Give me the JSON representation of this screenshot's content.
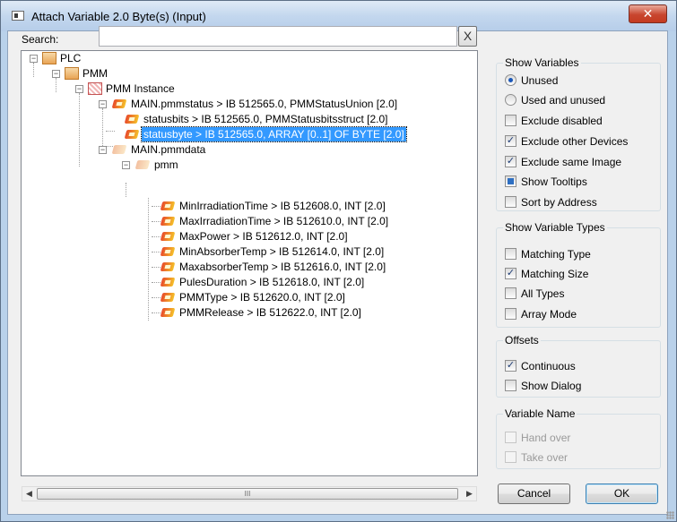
{
  "window": {
    "title": "Attach Variable 2.0 Byte(s) (Input)",
    "close_glyph": "✕"
  },
  "search": {
    "label": "Search:",
    "value": "",
    "clear_glyph": "X"
  },
  "tree": {
    "plc": "PLC",
    "pmm": "PMM",
    "pmm_instance": "PMM Instance",
    "pmmstatus": "MAIN.pmmstatus   >   IB 512565.0, PMMStatusUnion [2.0]",
    "statusbits": "statusbits   >   IB 512565.0, PMMStatusbitsstruct [2.0]",
    "statusbyte": "statusbyte   >   IB 512565.0, ARRAY [0..1] OF BYTE [2.0]",
    "pmmdata": "MAIN.pmmdata",
    "pmm_struct": "pmm",
    "items": [
      "MinIrradiationTime   >   IB 512608.0, INT [2.0]",
      "MaxIrradiationTime   >   IB 512610.0, INT [2.0]",
      "MaxPower   >   IB 512612.0, INT [2.0]",
      "MinAbsorberTemp   >   IB 512614.0, INT [2.0]",
      "MaxabsorberTemp   >   IB 512616.0, INT [2.0]",
      "PulesDuration   >   IB 512618.0, INT [2.0]",
      "PMMType   >   IB 512620.0, INT [2.0]",
      "PMMRelease   >   IB 512622.0, INT [2.0]"
    ]
  },
  "scrollbar": {
    "thumb_glyph": "III",
    "left_glyph": "◀",
    "right_glyph": "▶"
  },
  "show_variables": {
    "title": "Show Variables",
    "unused": "Unused",
    "used_and_unused": "Used and unused",
    "exclude_disabled": "Exclude disabled",
    "exclude_other_devices": "Exclude other Devices",
    "exclude_same_image": "Exclude same Image",
    "show_tooltips": "Show Tooltips",
    "sort_by_address": "Sort by Address"
  },
  "show_variable_types": {
    "title": "Show Variable Types",
    "matching_type": "Matching Type",
    "matching_size": "Matching Size",
    "all_types": "All Types",
    "array_mode": "Array Mode"
  },
  "offsets": {
    "title": "Offsets",
    "continuous": "Continuous",
    "show_dialog": "Show Dialog"
  },
  "variable_name": {
    "title": "Variable Name",
    "hand_over": "Hand over",
    "take_over": "Take over"
  },
  "buttons": {
    "cancel": "Cancel",
    "ok": "OK"
  },
  "check_glyph": "✓"
}
